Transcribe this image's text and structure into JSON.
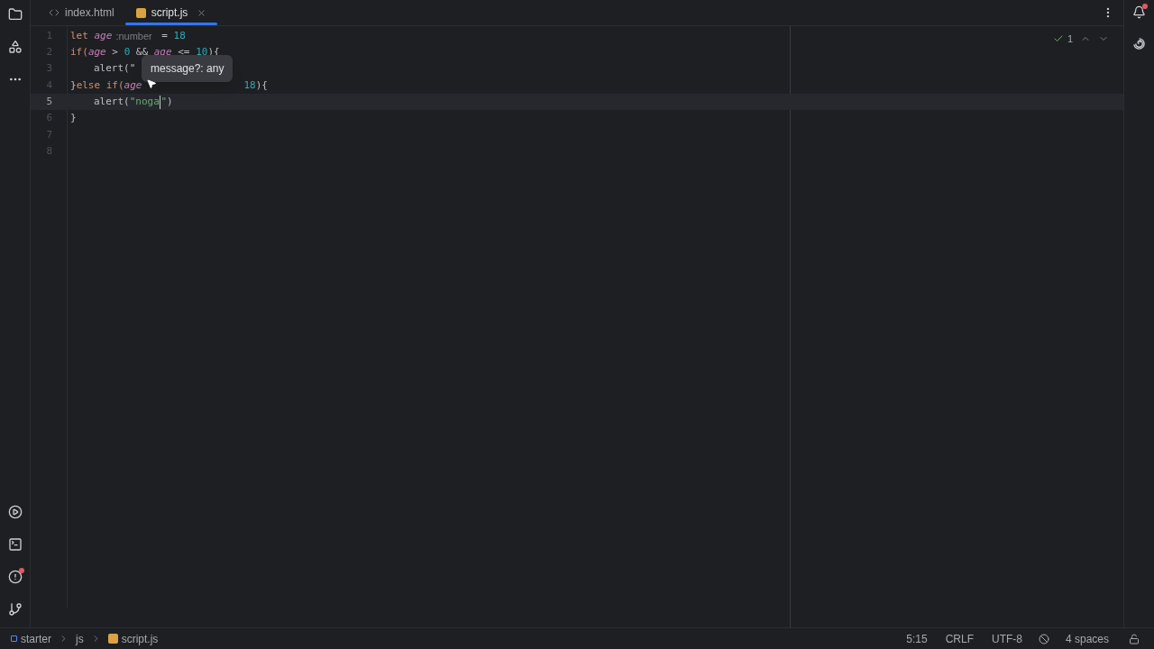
{
  "tabs": [
    {
      "label": "index.html",
      "kind": "html",
      "selected": false,
      "closable": false
    },
    {
      "label": "script.js",
      "kind": "js",
      "selected": true,
      "closable": true
    }
  ],
  "editor": {
    "inspection_count": "1",
    "lines": [
      {
        "number": "1",
        "current": false,
        "tokens": [
          {
            "kind": "keyword",
            "text": "let "
          },
          {
            "kind": "var",
            "text": "age"
          },
          {
            "kind": "hint",
            "text": ":number"
          },
          {
            "kind": "plain",
            "text": " = "
          },
          {
            "kind": "num",
            "text": "18"
          }
        ]
      },
      {
        "number": "2",
        "current": false,
        "tokens": [
          {
            "kind": "keyword",
            "text": "if("
          },
          {
            "kind": "var",
            "text": "age"
          },
          {
            "kind": "plain",
            "text": " > "
          },
          {
            "kind": "num",
            "text": "0"
          },
          {
            "kind": "plain",
            "text": " && "
          },
          {
            "kind": "var",
            "text": "age"
          },
          {
            "kind": "plain",
            "text": " <= "
          },
          {
            "kind": "num",
            "text": "10"
          },
          {
            "kind": "plain",
            "text": "){"
          }
        ]
      },
      {
        "number": "3",
        "current": false,
        "tokens": [
          {
            "kind": "indent"
          },
          {
            "kind": "plain",
            "text": "alert(\""
          }
        ]
      },
      {
        "number": "4",
        "current": false,
        "tokens": [
          {
            "kind": "plain",
            "text": "}"
          },
          {
            "kind": "keyword",
            "text": "else if("
          },
          {
            "kind": "var",
            "text": "age"
          },
          {
            "kind": "gap"
          },
          {
            "kind": "num",
            "text": "18"
          },
          {
            "kind": "plain",
            "text": "){"
          }
        ]
      },
      {
        "number": "5",
        "current": true,
        "tokens": [
          {
            "kind": "indent"
          },
          {
            "kind": "plain",
            "text": "alert("
          },
          {
            "kind": "string",
            "text": "\"noga"
          },
          {
            "kind": "caret"
          },
          {
            "kind": "string",
            "text": "\""
          },
          {
            "kind": "plain",
            "text": ")"
          }
        ]
      },
      {
        "number": "6",
        "current": false,
        "tokens": [
          {
            "kind": "plain",
            "text": "}"
          }
        ]
      },
      {
        "number": "7",
        "current": false
      },
      {
        "number": "8",
        "current": false
      }
    ],
    "tooltip": "message?: any"
  },
  "breadcrumbs": [
    {
      "label": "starter",
      "kind": "module"
    },
    {
      "label": "js",
      "kind": "folder"
    },
    {
      "label": "script.js",
      "kind": "js"
    }
  ],
  "status": [
    "5:15",
    "CRLF",
    "UTF-8",
    "4 spaces"
  ]
}
